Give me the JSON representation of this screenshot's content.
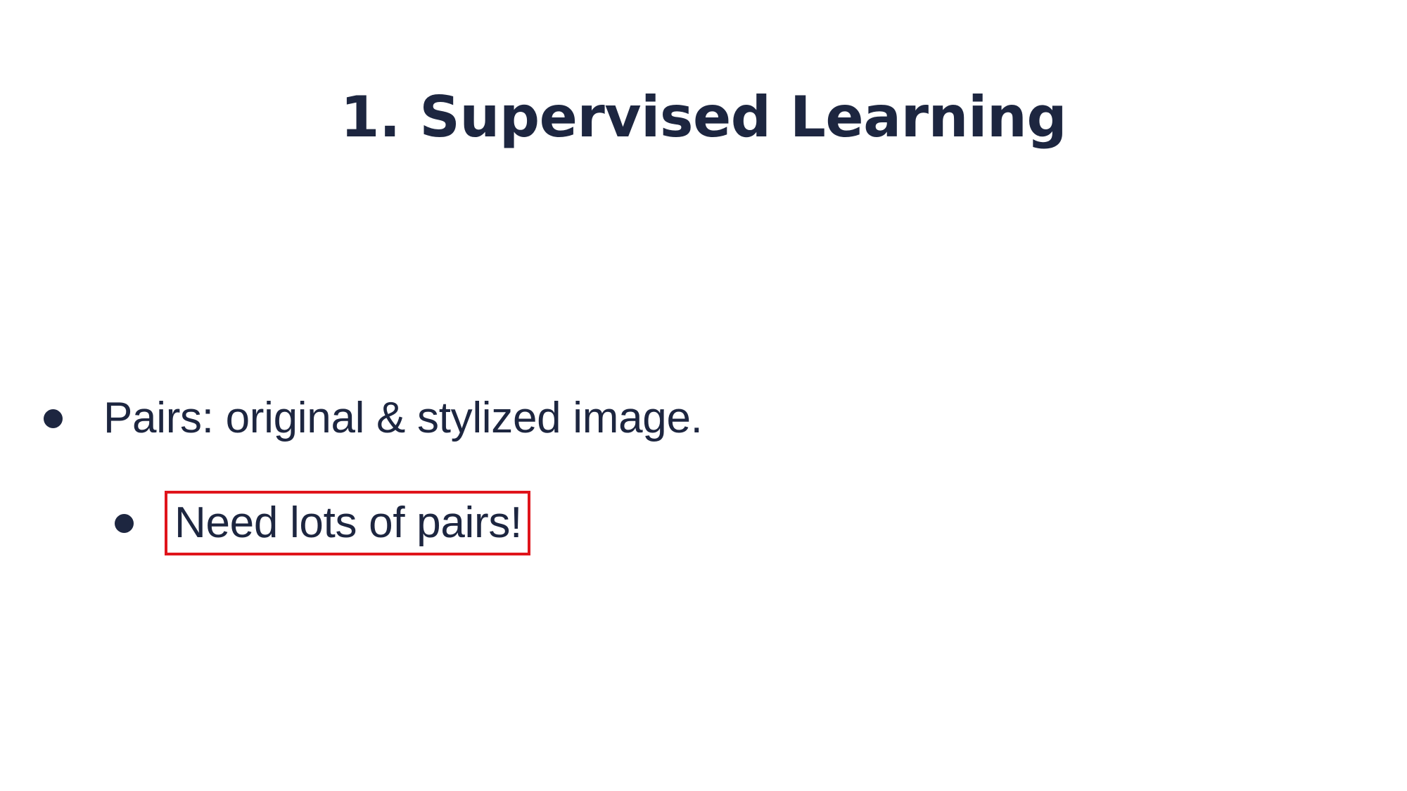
{
  "slide": {
    "title": "1. Supervised Learning",
    "bullets": [
      {
        "text": "Pairs: original & stylized image."
      },
      {
        "text": "Need lots of pairs!"
      }
    ],
    "colors": {
      "text": "#1d2640",
      "highlight_border": "#e0141b",
      "background": "#ffffff"
    }
  }
}
